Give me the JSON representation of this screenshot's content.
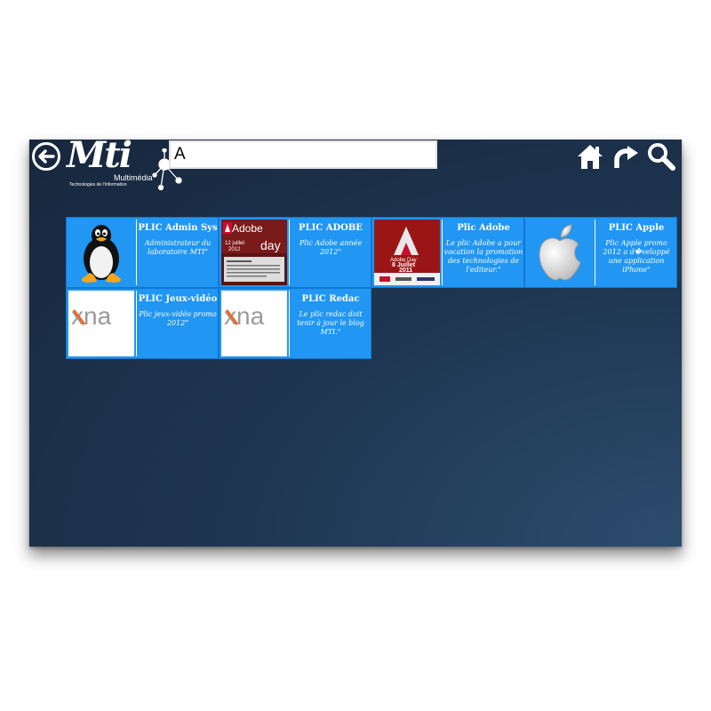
{
  "header": {
    "logo": {
      "title": "Mti",
      "subtitle": "Multimédia",
      "tagline": "Technologies de l'Information"
    },
    "search": {
      "value": "A",
      "placeholder": ""
    },
    "toolbar": {
      "icons": [
        "back-arrow-icon",
        "home-icon",
        "refresh-icon",
        "search-icon"
      ]
    }
  },
  "tiles": [
    {
      "title": "PLIC Admin Sys",
      "description": "Administrateur du laboratoire MTI\"",
      "thumbnail": "tux-penguin"
    },
    {
      "title": "PLIC ADOBE",
      "description": "Plic Adobe année 2012\"",
      "thumbnail": "adobe-day-2012-poster",
      "poster": {
        "brand": "Adobe",
        "word": "day",
        "date": "12 juillet",
        "year": "2012"
      }
    },
    {
      "title": "Plic Adobe",
      "description": "Le plic Adobe a pour vocation la promotion des technologies de l'editeur.\"",
      "thumbnail": "adobe-day-2011-poster",
      "poster": {
        "line1": "Adobe Day",
        "line2": "8 Juillet",
        "line3": "2011"
      }
    },
    {
      "title": "PLIC Apple",
      "description": "Plic Apple promo 2012 a d�veloppé une application iPhone\"",
      "thumbnail": "apple-logo"
    },
    {
      "title": "PLIC Jeux-vidéo",
      "description": "Plic jeux-vidéo promo 2012\"",
      "thumbnail": "xna-logo",
      "logo_text": "xna"
    },
    {
      "title": "PLIC Redac",
      "description": "Le plic redac doit tenir à jour le blog MTI.\"",
      "thumbnail": "xna-logo",
      "logo_text": "xna"
    }
  ],
  "colors": {
    "tile": "#2196f3",
    "background": "#1f3753",
    "adobe_red": "#c8102e"
  }
}
